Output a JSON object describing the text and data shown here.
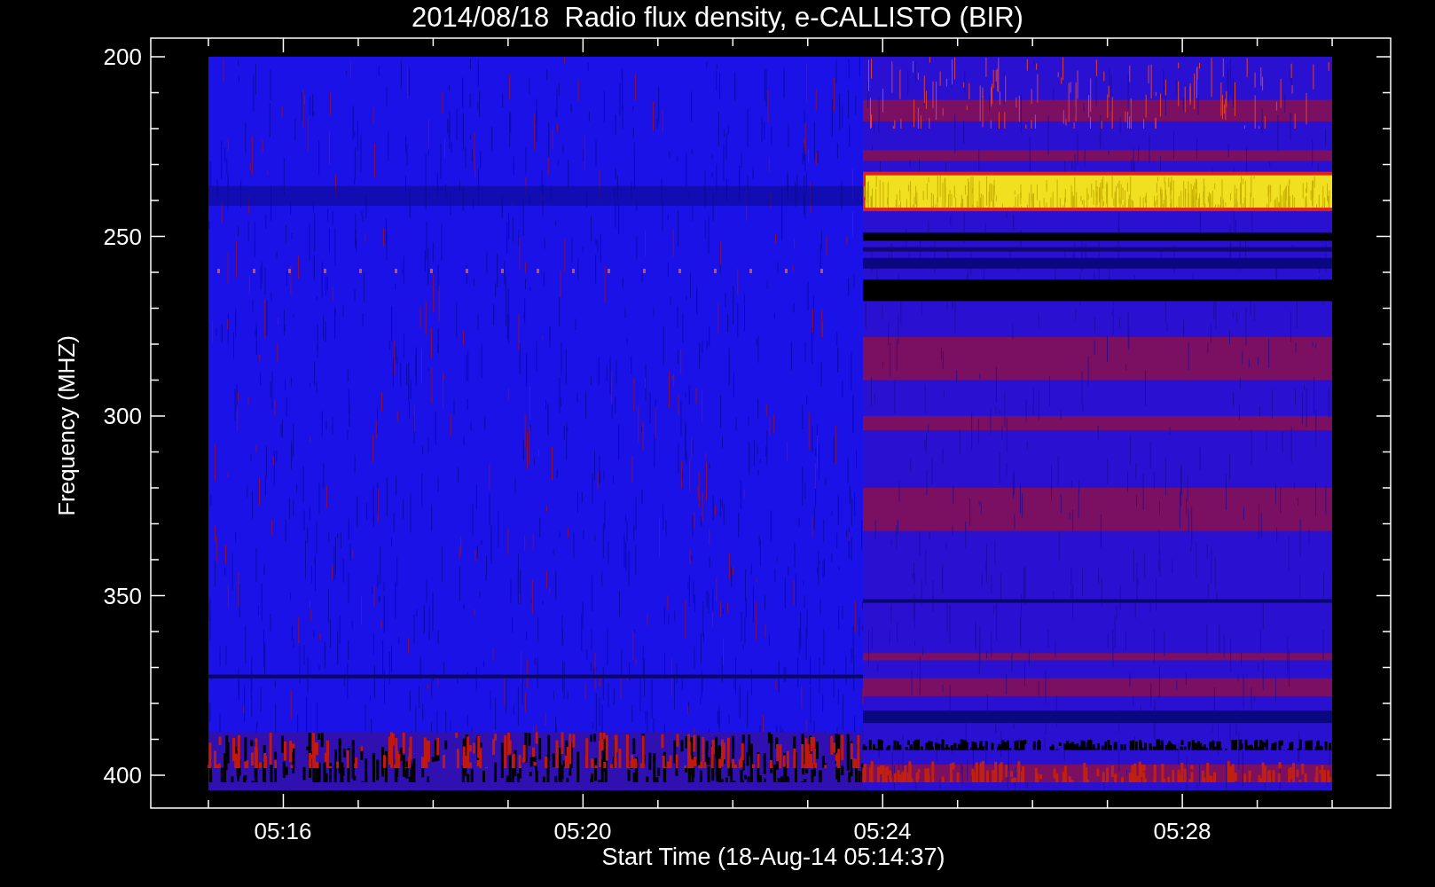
{
  "title": "2014/08/18  Radio flux density, e-CALLISTO (BIR)",
  "y_axis": {
    "label": "Frequency (MHZ)",
    "ticks": [
      "200",
      "250",
      "300",
      "350",
      "400"
    ]
  },
  "x_axis": {
    "label": "Start Time (18-Aug-14 05:14:37)",
    "ticks": [
      "05:16",
      "05:20",
      "05:24",
      "05:28"
    ]
  }
}
